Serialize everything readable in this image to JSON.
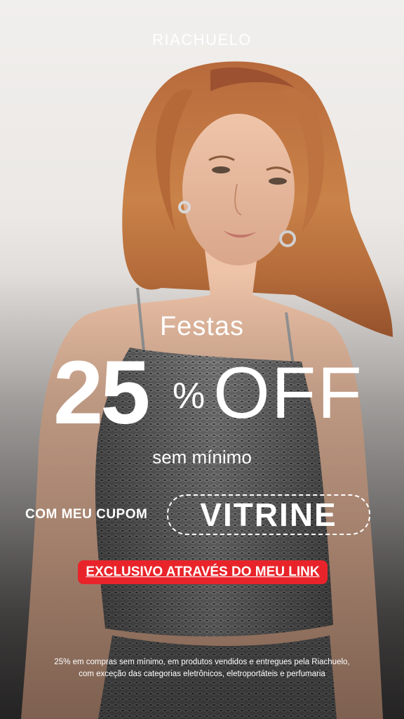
{
  "brand": {
    "logo_text": "RIACHUELO"
  },
  "promo": {
    "category": "Festas",
    "discount_number": "25",
    "discount_symbol": "%",
    "discount_word": "OFF",
    "subtitle": "sem mínimo",
    "coupon_label": "COM MEU CUPOM",
    "coupon_code": "VITRINE",
    "exclusive_banner": "EXCLUSIVO ATRAVÉS DO MEU LINK",
    "disclaimer_line1": "25% em compras sem mínimo, em produtos vendidos e entregues pela Riachuelo,",
    "disclaimer_line2": "com exceção das categorias eletrônicos, eletroportáteis e perfumaria"
  },
  "colors": {
    "banner_red": "#e8242a",
    "text": "#ffffff",
    "background_top": "#f1efed",
    "background_bottom": "#3e3c3c"
  }
}
